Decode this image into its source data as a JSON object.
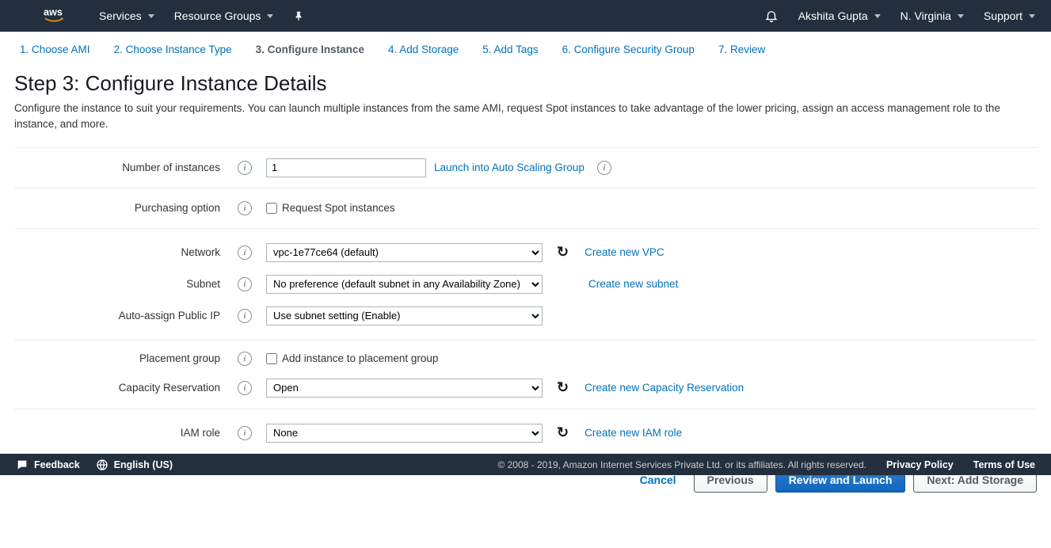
{
  "topnav": {
    "services": "Services",
    "resource_groups": "Resource Groups",
    "user": "Akshita Gupta",
    "region": "N. Virginia",
    "support": "Support"
  },
  "steps": [
    "1. Choose AMI",
    "2. Choose Instance Type",
    "3. Configure Instance",
    "4. Add Storage",
    "5. Add Tags",
    "6. Configure Security Group",
    "7. Review"
  ],
  "page": {
    "title": "Step 3: Configure Instance Details",
    "desc": "Configure the instance to suit your requirements. You can launch multiple instances from the same AMI, request Spot instances to take advantage of the lower pricing, assign an access management role to the instance, and more."
  },
  "form": {
    "num_instances_label": "Number of instances",
    "num_instances_value": "1",
    "launch_asg": "Launch into Auto Scaling Group",
    "purchasing_label": "Purchasing option",
    "purchasing_checkbox": "Request Spot instances",
    "network_label": "Network",
    "network_value": "vpc-1e77ce64 (default)",
    "create_vpc": "Create new VPC",
    "subnet_label": "Subnet",
    "subnet_value": "No preference (default subnet in any Availability Zone)",
    "create_subnet": "Create new subnet",
    "autoip_label": "Auto-assign Public IP",
    "autoip_value": "Use subnet setting (Enable)",
    "placement_label": "Placement group",
    "placement_checkbox": "Add instance to placement group",
    "capacity_label": "Capacity Reservation",
    "capacity_value": "Open",
    "create_capacity": "Create new Capacity Reservation",
    "iam_label": "IAM role",
    "iam_value": "None",
    "create_iam": "Create new IAM role"
  },
  "buttons": {
    "cancel": "Cancel",
    "previous": "Previous",
    "review": "Review and Launch",
    "next": "Next: Add Storage"
  },
  "footer": {
    "feedback": "Feedback",
    "language": "English (US)",
    "copyright": "© 2008 - 2019, Amazon Internet Services Private Ltd. or its affiliates. All rights reserved.",
    "privacy": "Privacy Policy",
    "terms": "Terms of Use"
  }
}
